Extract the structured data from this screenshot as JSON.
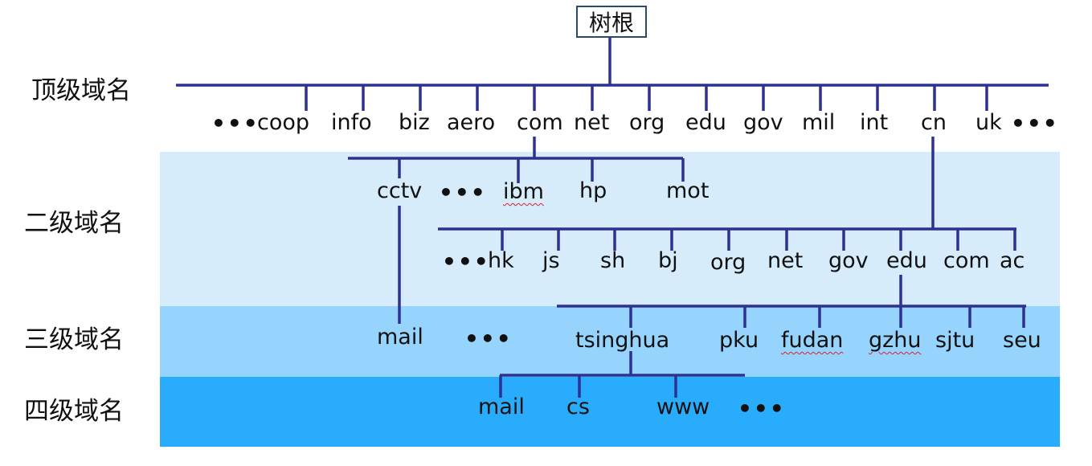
{
  "root": "树根",
  "levels": {
    "top": "顶级域名",
    "second": "二级域名",
    "third": "三级域名",
    "fourth": "四级域名"
  },
  "ellipsis": "•••",
  "top_level_domains": [
    "coop",
    "info",
    "biz",
    "aero",
    "com",
    "net",
    "org",
    "edu",
    "gov",
    "mil",
    "int",
    "cn",
    "uk"
  ],
  "com_children": [
    "cctv",
    "ibm",
    "hp",
    "mot"
  ],
  "cn_children": [
    "hk",
    "js",
    "sh",
    "bj",
    "org",
    "net",
    "gov",
    "edu",
    "com",
    "ac"
  ],
  "cctv_children": [
    "mail"
  ],
  "edu_children": [
    "tsinghua",
    "pku",
    "fudan",
    "gzhu",
    "sjtu",
    "seu"
  ],
  "tsinghua_children": [
    "mail",
    "cs",
    "www"
  ],
  "colors": {
    "line": "#2e3192",
    "band_second": "#d6ecfb",
    "band_third": "#96d4fd",
    "band_fourth": "#2aacfd",
    "spell_underline": "#d23"
  }
}
